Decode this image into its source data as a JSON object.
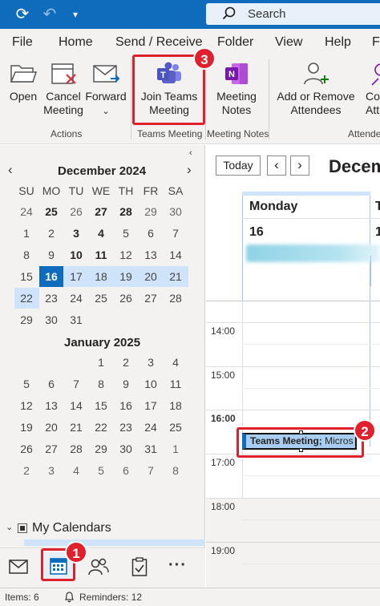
{
  "titlebar": {
    "search_placeholder": "Search"
  },
  "menu": [
    "File",
    "Home",
    "Send / Receive",
    "Folder",
    "View",
    "Help",
    "F"
  ],
  "ribbon": {
    "open": "Open",
    "cancel_meeting_1": "Cancel",
    "cancel_meeting_2": "Meeting",
    "forward": "Forward",
    "join_teams_1": "Join Teams",
    "join_teams_2": "Meeting",
    "meeting_notes_1": "Meeting",
    "meeting_notes_2": "Notes",
    "add_remove_1": "Add or Remove",
    "add_remove_2": "Attendees",
    "co_1": "Co",
    "co_2": "Att",
    "groups": {
      "actions": "Actions",
      "teams": "Teams Meeting",
      "notes": "Meeting Notes",
      "attendees": "Attende"
    }
  },
  "mini_calendars": [
    {
      "title": "December 2024",
      "daynames": [
        "SU",
        "MO",
        "TU",
        "WE",
        "TH",
        "FR",
        "SA"
      ],
      "weeks": [
        [
          "24",
          "25",
          "26",
          "27",
          "28",
          "29",
          "30"
        ],
        [
          "1",
          "2",
          "3",
          "4",
          "5",
          "6",
          "7"
        ],
        [
          "8",
          "9",
          "10",
          "11",
          "12",
          "13",
          "14"
        ],
        [
          "15",
          "16",
          "17",
          "18",
          "19",
          "20",
          "21"
        ],
        [
          "22",
          "23",
          "24",
          "25",
          "26",
          "27",
          "28"
        ],
        [
          "29",
          "30",
          "31",
          "",
          "",
          "",
          ""
        ]
      ]
    },
    {
      "title": "January 2025",
      "weeks": [
        [
          "",
          "",
          "",
          "1",
          "2",
          "3",
          "4"
        ],
        [
          "5",
          "6",
          "7",
          "8",
          "9",
          "10",
          "11"
        ],
        [
          "12",
          "13",
          "14",
          "15",
          "16",
          "17",
          "18"
        ],
        [
          "19",
          "20",
          "21",
          "22",
          "23",
          "24",
          "25"
        ],
        [
          "26",
          "27",
          "28",
          "29",
          "30",
          "31",
          "1"
        ],
        [
          "2",
          "3",
          "4",
          "5",
          "6",
          "7",
          "8"
        ]
      ]
    }
  ],
  "my_calendars": "My Calendars",
  "calendar_view": {
    "today_button": "Today",
    "month_title": "Decem",
    "day_name": "Monday",
    "day_number": "16",
    "next_day_initial": "T",
    "next_day_number": "1",
    "hours": [
      "14:00",
      "15:00",
      "16:00",
      "17:00",
      "18:00",
      "19:00"
    ],
    "event": {
      "title": "Teams Meeting;",
      "subtitle": "Micros"
    }
  },
  "status": {
    "items": "Items: 6",
    "reminders": "Reminders: 12"
  },
  "callouts": [
    "1",
    "2",
    "3"
  ],
  "colors": {
    "accent": "#0f6cbd",
    "callout": "#e0202c",
    "teams_purple": "#5b5fc7",
    "onenote_purple": "#7719aa"
  }
}
